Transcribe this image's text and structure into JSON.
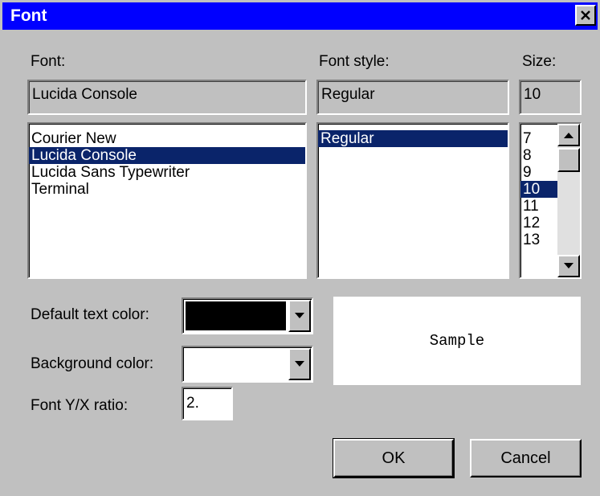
{
  "window": {
    "title": "Font",
    "close_glyph": "close-icon"
  },
  "font": {
    "label": "Font:",
    "value": "Lucida Console",
    "options": [
      "Courier New",
      "Lucida Console",
      "Lucida Sans Typewriter",
      "Terminal"
    ],
    "selected": "Lucida Console"
  },
  "style": {
    "label": "Font style:",
    "value": "Regular",
    "options": [
      "Regular"
    ],
    "selected": "Regular"
  },
  "size": {
    "label": "Size:",
    "value": "10",
    "options": [
      "7",
      "8",
      "9",
      "10",
      "11",
      "12",
      "13"
    ],
    "selected": "10"
  },
  "colors": {
    "text_label": "Default text color:",
    "text_color": "#000000",
    "bg_label": "Background color:",
    "bg_color": "#ffffff"
  },
  "ratio": {
    "label": "Font Y/X ratio:",
    "value": "2."
  },
  "sample": {
    "text": "Sample"
  },
  "buttons": {
    "ok": "OK",
    "cancel": "Cancel"
  },
  "theme": {
    "titlebar": "#0000ff",
    "face": "#c0c0c0",
    "selection": "#0a246a"
  }
}
